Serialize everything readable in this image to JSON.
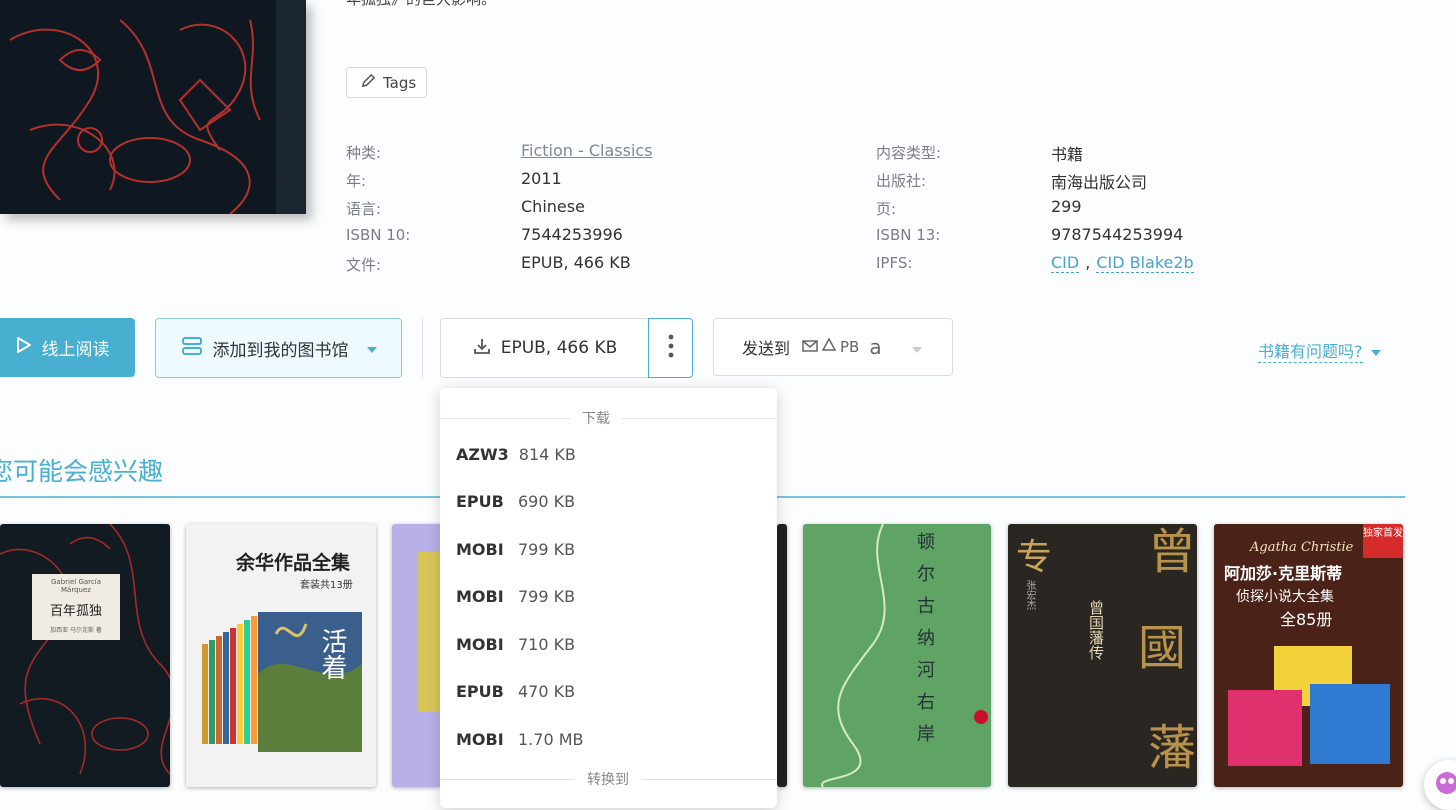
{
  "description_tail": "年孤独》的巨大影响。",
  "tags_label": "Tags",
  "meta": {
    "category_label": "种类:",
    "category_value": "Fiction - Classics",
    "year_label": "年:",
    "year_value": "2011",
    "language_label": "语言:",
    "language_value": "Chinese",
    "isbn10_label": "ISBN 10:",
    "isbn10_value": "7544253996",
    "file_label": "文件:",
    "file_value": "EPUB, 466 KB",
    "content_type_label": "内容类型:",
    "content_type_value": "书籍",
    "publisher_label": "出版社:",
    "publisher_value": "南海出版公司",
    "pages_label": "页:",
    "pages_value": "299",
    "isbn13_label": "ISBN 13:",
    "isbn13_value": "9787544253994",
    "ipfs_label": "IPFS:",
    "ipfs_cid": "CID",
    "ipfs_sep": ",",
    "ipfs_blake": "CID Blake2b"
  },
  "actions": {
    "read_online": "线上阅读",
    "add_to_library": "添加到我的图书馆",
    "download": "EPUB, 466 KB",
    "send_to": "发送到",
    "send_pb": "PB",
    "send_amazon": "a",
    "problem": "书籍有问题吗?"
  },
  "section_title": "您可能会感兴趣",
  "dropdown": {
    "download_header": "下载",
    "convert_header": "转换到",
    "items": [
      {
        "format": "AZW3",
        "size": "814 KB"
      },
      {
        "format": "EPUB",
        "size": "690 KB"
      },
      {
        "format": "MOBI",
        "size": "799 KB"
      },
      {
        "format": "MOBI",
        "size": "799 KB"
      },
      {
        "format": "MOBI",
        "size": "710 KB"
      },
      {
        "format": "EPUB",
        "size": "470 KB"
      },
      {
        "format": "MOBI",
        "size": "1.70 MB"
      }
    ]
  },
  "covers": {
    "c1_author": "Gabriel García Márquez",
    "c1_title": "百年孤独",
    "c1_sub": "加西亚·马尔克斯 著",
    "c2_title": "余华作品全集",
    "c2_sub": "套装共13册",
    "c2_book": "活着",
    "c5_title": "顿尔古纳河右岸",
    "c6_title": "曾国藩传",
    "c6_author": "张宏杰",
    "c6_big1": "曾",
    "c6_big2": "國",
    "c6_big3": "藩",
    "c6_tag": "专",
    "c7_brand": "Agatha Christie",
    "c7_title": "阿加莎·克里斯蒂",
    "c7_sub": "侦探小说大全集",
    "c7_count": "全85册",
    "c7_badge": "独家首发"
  },
  "colors": {
    "accent": "#49afd1",
    "cover_dark": "#0f1820",
    "cover_lines": "#b5302c"
  }
}
